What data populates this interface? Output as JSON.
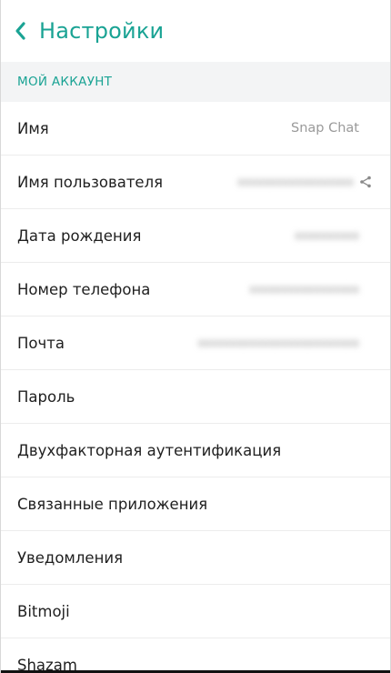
{
  "header": {
    "title": "Настройки",
    "accent_color": "#1aa394",
    "back_icon": "chevron-left-icon"
  },
  "section": {
    "title": "МОЙ АККАУНТ"
  },
  "rows": [
    {
      "label": "Имя",
      "value": "Snap Chat"
    },
    {
      "label": "Имя пользователя",
      "value": "",
      "icon": "share-icon"
    },
    {
      "label": "Дата рождения",
      "value": ""
    },
    {
      "label": "Номер телефона",
      "value": ""
    },
    {
      "label": "Почта",
      "value": ""
    },
    {
      "label": "Пароль",
      "value": ""
    },
    {
      "label": "Двухфакторная аутентификация",
      "value": ""
    },
    {
      "label": "Связанные приложения",
      "value": ""
    },
    {
      "label": "Уведомления",
      "value": ""
    },
    {
      "label": "Bitmoji",
      "value": ""
    },
    {
      "label": "Shazam",
      "value": ""
    }
  ]
}
